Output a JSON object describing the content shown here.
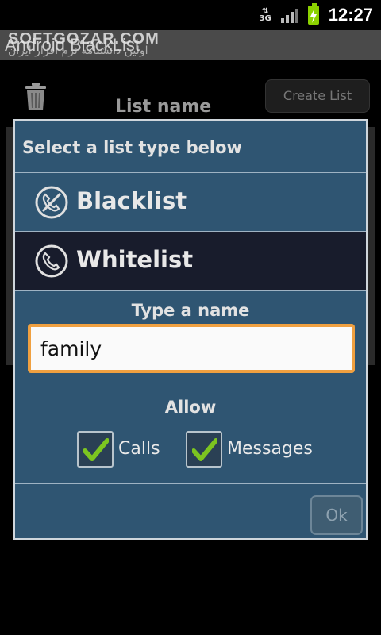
{
  "status_bar": {
    "network": "3G",
    "time": "12:27"
  },
  "app": {
    "title": "Android BlackList",
    "watermark": "SOFTGOZAR.COM",
    "watermark_subtitle": "اولین دانشنامه نرم افزار ایران"
  },
  "background": {
    "list_name_label": "List name",
    "create_list_label": "Create List"
  },
  "dialog": {
    "title": "Select a list type below",
    "options": [
      {
        "label": "Blacklist",
        "icon": "phone-blocked-icon",
        "selected": false
      },
      {
        "label": "Whitelist",
        "icon": "phone-icon",
        "selected": true
      }
    ],
    "name_label": "Type a name",
    "name_value": "family",
    "allow_label": "Allow",
    "allow_calls_label": "Calls",
    "allow_calls_checked": true,
    "allow_messages_label": "Messages",
    "allow_messages_checked": true,
    "ok_label": "Ok"
  },
  "colors": {
    "dialog_bg": "#2f5572",
    "selected_option_bg": "#181c2c",
    "input_focus_border": "#f0a040",
    "checkmark": "#7cc520"
  }
}
